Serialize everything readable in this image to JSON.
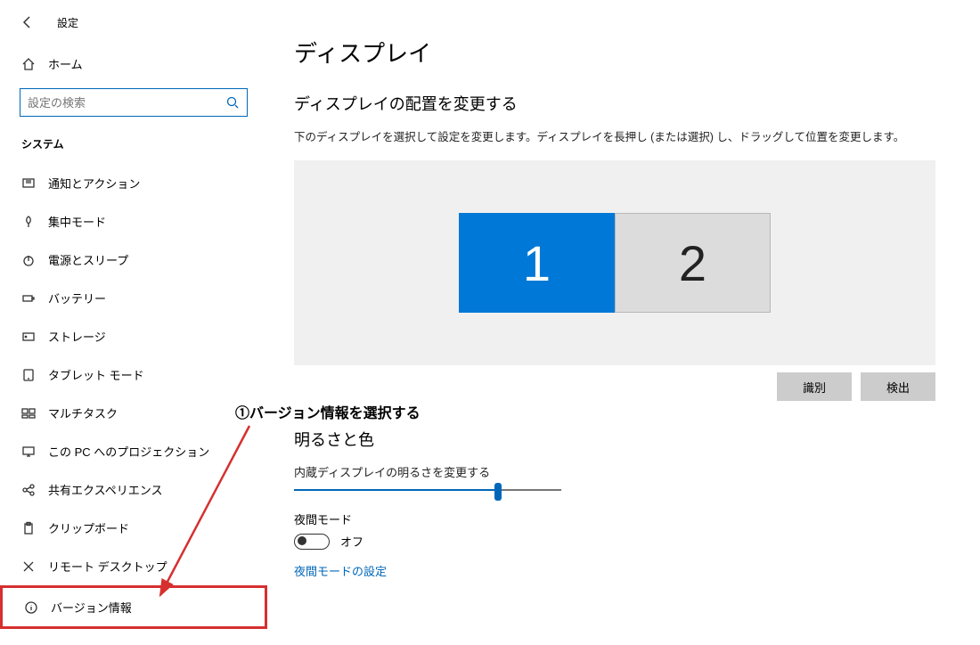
{
  "header": {
    "title": "設定"
  },
  "sidebar": {
    "home_label": "ホーム",
    "search_placeholder": "設定の検索",
    "category": "システム",
    "items": [
      {
        "label": "通知とアクション",
        "icon": "notification"
      },
      {
        "label": "集中モード",
        "icon": "focus"
      },
      {
        "label": "電源とスリープ",
        "icon": "power"
      },
      {
        "label": "バッテリー",
        "icon": "battery"
      },
      {
        "label": "ストレージ",
        "icon": "storage"
      },
      {
        "label": "タブレット モード",
        "icon": "tablet"
      },
      {
        "label": "マルチタスク",
        "icon": "multitask"
      },
      {
        "label": "この PC へのプロジェクション",
        "icon": "project"
      },
      {
        "label": "共有エクスペリエンス",
        "icon": "share"
      },
      {
        "label": "クリップボード",
        "icon": "clipboard"
      },
      {
        "label": "リモート デスクトップ",
        "icon": "remote"
      },
      {
        "label": "バージョン情報",
        "icon": "about",
        "highlight": true
      }
    ]
  },
  "main": {
    "title": "ディスプレイ",
    "arrange_title": "ディスプレイの配置を変更する",
    "arrange_help": "下のディスプレイを選択して設定を変更します。ディスプレイを長押し (または選択) し、ドラッグして位置を変更します。",
    "monitors": [
      "1",
      "2"
    ],
    "identify_btn": "識別",
    "detect_btn": "検出",
    "bright_title": "明るさと色",
    "bright_sub": "内蔵ディスプレイの明るさを変更する",
    "night_label": "夜間モード",
    "night_state": "オフ",
    "night_link": "夜間モードの設定"
  },
  "annotation": {
    "label": "①バージョン情報を選択する"
  }
}
